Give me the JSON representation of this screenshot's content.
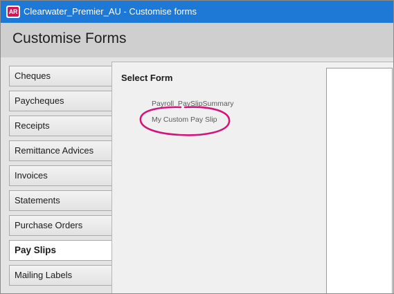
{
  "window": {
    "app_icon_text": "AR",
    "title": "Clearwater_Premier_AU - Customise forms"
  },
  "header": {
    "title": "Customise Forms"
  },
  "sidebar": {
    "items": [
      {
        "label": "Cheques",
        "active": false
      },
      {
        "label": "Paycheques",
        "active": false
      },
      {
        "label": "Receipts",
        "active": false
      },
      {
        "label": "Remittance Advices",
        "active": false
      },
      {
        "label": "Invoices",
        "active": false
      },
      {
        "label": "Statements",
        "active": false
      },
      {
        "label": "Purchase Orders",
        "active": false
      },
      {
        "label": "Pay Slips",
        "active": true
      },
      {
        "label": "Mailing Labels",
        "active": false
      }
    ]
  },
  "main": {
    "select_form_label": "Select Form",
    "forms": [
      "Payroll_PaySlipSummary",
      "My Custom Pay Slip"
    ]
  },
  "colors": {
    "titlebar": "#1e78d6",
    "highlight_oval": "#d4147a"
  }
}
